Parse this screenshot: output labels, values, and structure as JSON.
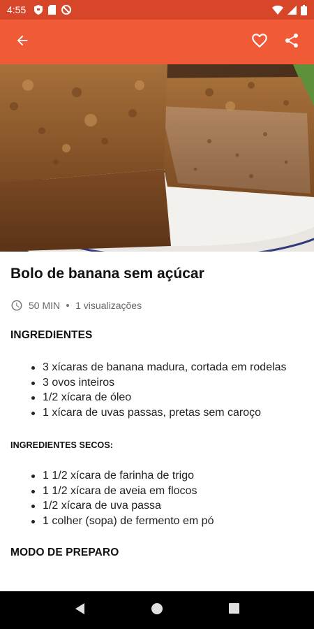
{
  "status_bar": {
    "time": "4:55",
    "left_icons": [
      "shield-icon",
      "sim-card-icon",
      "do-not-disturb-icon"
    ],
    "right_icons": [
      "wifi-icon",
      "signal-icon",
      "battery-icon"
    ]
  },
  "app_bar": {
    "icons": [
      "back-arrow-icon",
      "heart-outline-icon",
      "share-icon"
    ],
    "color": "#f05a36"
  },
  "hero": {
    "alt": "Bolo de banana sem açúcar"
  },
  "recipe": {
    "title": "Bolo de banana sem açúcar",
    "time": "50 MIN",
    "views": "1 visualizações"
  },
  "sections": {
    "ingredients": {
      "title": "INGREDIENTES",
      "items": [
        "3 xícaras de banana madura, cortada em rodelas",
        "3 ovos inteiros",
        "1/2 xícara de óleo",
        "1 xícara de uvas passas, pretas sem caroço"
      ]
    },
    "dry_ingredients": {
      "title": "INGREDIENTES SECOS:",
      "items": [
        "1 1/2 xícara de farinha de trigo",
        "1 1/2 xícara de aveia em flocos",
        "1/2 xícara de uva passa",
        "1 colher (sopa) de fermento em pó"
      ]
    },
    "preparation": {
      "title": "MODO DE PREPARO"
    }
  },
  "nav_bar": {
    "icons": [
      "back-triangle-icon",
      "home-circle-icon",
      "recents-square-icon"
    ]
  }
}
